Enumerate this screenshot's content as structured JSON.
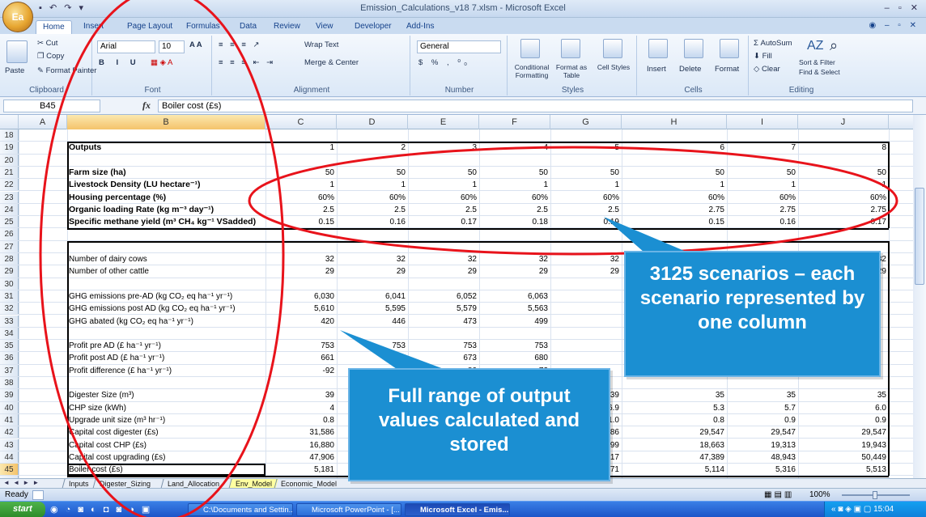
{
  "window": {
    "title": "Emission_Calculations_v18 7.xlsm - Microsoft Excel",
    "qat": "▪ ↶ ↷ ▾",
    "controls": "– ▫ ✕",
    "ribbon_controls": "◉ – ▫ ✕"
  },
  "office_button": {
    "label": "Ea"
  },
  "ribbon_tabs": [
    "Home",
    "Insert",
    "Page Layout",
    "Formulas",
    "Data",
    "Review",
    "View",
    "Developer",
    "Add-Ins"
  ],
  "ribbon": {
    "clipboard": {
      "paste": "Paste",
      "cut": "Cut",
      "copy": "Copy",
      "format_painter": "Format Painter",
      "label": "Clipboard"
    },
    "font": {
      "family": "Arial",
      "size": "10",
      "label": "Font"
    },
    "alignment": {
      "wrap": "Wrap Text",
      "merge": "Merge & Center",
      "label": "Alignment"
    },
    "number": {
      "format": "General",
      "label": "Number"
    },
    "styles": {
      "conditional": "Conditional Formatting",
      "format_table": "Format as Table",
      "cell_styles": "Cell Styles",
      "label": "Styles"
    },
    "cells": {
      "insert": "Insert",
      "delete": "Delete",
      "format": "Format",
      "label": "Cells"
    },
    "editing": {
      "autosum": "AutoSum",
      "fill": "Fill",
      "clear": "Clear",
      "sort": "Sort & Filter",
      "find": "Find & Select",
      "label": "Editing"
    }
  },
  "formula_bar": {
    "name_box": "B45",
    "fx": "fx",
    "value": "Boiler cost (£s)"
  },
  "columns": [
    "A",
    "B",
    "C",
    "D",
    "E",
    "F",
    "G",
    "H",
    "I",
    "J"
  ],
  "rows": [
    {
      "n": "18",
      "label": "",
      "bold": false,
      "values": [
        "",
        "",
        "",
        "",
        "",
        "",
        "",
        ""
      ]
    },
    {
      "n": "19",
      "label": "Outputs",
      "bold": true,
      "values": [
        "1",
        "2",
        "3",
        "4",
        "5",
        "6",
        "7",
        "8"
      ]
    },
    {
      "n": "20",
      "label": "",
      "bold": false,
      "values": [
        "",
        "",
        "",
        "",
        "",
        "",
        "",
        ""
      ]
    },
    {
      "n": "21",
      "label": "Farm size (ha)",
      "bold": true,
      "values": [
        "50",
        "50",
        "50",
        "50",
        "50",
        "50",
        "50",
        "50"
      ]
    },
    {
      "n": "22",
      "label": "Livestock Density (LU hectare⁻¹)",
      "bold": true,
      "values": [
        "1",
        "1",
        "1",
        "1",
        "1",
        "1",
        "1",
        "1"
      ]
    },
    {
      "n": "23",
      "label": "Housing percentage (%)",
      "bold": true,
      "values": [
        "60%",
        "60%",
        "60%",
        "60%",
        "60%",
        "60%",
        "60%",
        "60%"
      ]
    },
    {
      "n": "24",
      "label": "Organic loading Rate (kg m⁻³ day⁻¹)",
      "bold": true,
      "values": [
        "2.5",
        "2.5",
        "2.5",
        "2.5",
        "2.5",
        "2.75",
        "2.75",
        "2.75"
      ]
    },
    {
      "n": "25",
      "label": "Specific methane yield (m³ CH₄ kg⁻¹ VSadded)",
      "bold": true,
      "values": [
        "0.15",
        "0.16",
        "0.17",
        "0.18",
        "0.19",
        "0.15",
        "0.16",
        "0.17"
      ]
    },
    {
      "n": "26",
      "label": "",
      "bold": false,
      "values": [
        "",
        "",
        "",
        "",
        "",
        "",
        "",
        ""
      ]
    },
    {
      "n": "27",
      "label": "",
      "bold": false,
      "values": [
        "",
        "",
        "",
        "",
        "",
        "",
        "",
        ""
      ]
    },
    {
      "n": "28",
      "label": "Number of dairy cows",
      "bold": false,
      "values": [
        "32",
        "32",
        "32",
        "32",
        "32",
        "32",
        "32",
        "32"
      ]
    },
    {
      "n": "29",
      "label": "Number of other cattle",
      "bold": false,
      "values": [
        "29",
        "29",
        "29",
        "29",
        "29",
        "29",
        "29",
        "29"
      ]
    },
    {
      "n": "30",
      "label": "",
      "bold": false,
      "values": [
        "",
        "",
        "",
        "",
        "",
        "",
        "",
        ""
      ]
    },
    {
      "n": "31",
      "label": "GHG emissions pre-AD (kg CO₂ eq ha⁻¹ yr⁻¹)",
      "bold": false,
      "values": [
        "6,030",
        "6,041",
        "6,052",
        "6,063",
        "",
        "",
        "",
        ""
      ]
    },
    {
      "n": "32",
      "label": "GHG emissions post AD (kg CO₂ eq ha⁻¹ yr⁻¹)",
      "bold": false,
      "values": [
        "5,610",
        "5,595",
        "5,579",
        "5,563",
        "",
        "",
        "",
        ""
      ]
    },
    {
      "n": "33",
      "label": "GHG abated (kg CO₂ eq ha⁻¹ yr⁻¹)",
      "bold": false,
      "values": [
        "420",
        "446",
        "473",
        "499",
        "",
        "",
        "",
        ""
      ]
    },
    {
      "n": "34",
      "label": "",
      "bold": false,
      "values": [
        "",
        "",
        "",
        "",
        "",
        "",
        "",
        ""
      ]
    },
    {
      "n": "35",
      "label": "Profit pre AD (£ ha⁻¹ yr⁻¹)",
      "bold": false,
      "values": [
        "753",
        "753",
        "753",
        "753",
        "",
        "",
        "",
        ""
      ]
    },
    {
      "n": "36",
      "label": "Profit post AD (£ ha⁻¹ yr⁻¹)",
      "bold": false,
      "values": [
        "661",
        "667",
        "673",
        "680",
        "",
        "",
        "",
        ""
      ]
    },
    {
      "n": "37",
      "label": "Profit difference (£ ha⁻¹ yr⁻¹)",
      "bold": false,
      "values": [
        "-92",
        "-86",
        "-80",
        "-73",
        "",
        "",
        "",
        ""
      ]
    },
    {
      "n": "38",
      "label": "",
      "bold": false,
      "values": [
        "",
        "",
        "",
        "",
        "",
        "",
        "",
        ""
      ]
    },
    {
      "n": "39",
      "label": "Digester Size (m³)",
      "bold": false,
      "values": [
        "39",
        "",
        "",
        "",
        "39",
        "35",
        "35",
        "35"
      ]
    },
    {
      "n": "40",
      "label": "CHP size (kWh)",
      "bold": false,
      "values": [
        "4",
        "",
        "",
        "",
        "6.9",
        "5.3",
        "5.7",
        "6.0"
      ]
    },
    {
      "n": "41",
      "label": "Upgrade unit size (m³ hr⁻¹)",
      "bold": false,
      "values": [
        "0.8",
        "",
        "",
        "",
        "1.0",
        "0.8",
        "0.9",
        "0.9"
      ]
    },
    {
      "n": "42",
      "label": "Capital cost digester (£s)",
      "bold": false,
      "values": [
        "31,586",
        "",
        "",
        "",
        "31,586",
        "29,547",
        "29,547",
        "29,547"
      ]
    },
    {
      "n": "43",
      "label": "Capital cost CHP (£s)",
      "bold": false,
      "values": [
        "16,880",
        "",
        "",
        "",
        "21,399",
        "18,663",
        "19,313",
        "19,943"
      ]
    },
    {
      "n": "44",
      "label": "Capital cost upgrading (£s)",
      "bold": false,
      "values": [
        "47,906",
        "",
        "",
        "",
        "53,917",
        "47,389",
        "48,943",
        "50,449"
      ]
    },
    {
      "n": "45",
      "label": "Boiler cost (£s)",
      "bold": false,
      "values": [
        "5,181",
        "",
        "",
        "",
        "5,971",
        "5,114",
        "5,316",
        "5,513"
      ]
    },
    {
      "n": "46",
      "label": "",
      "bold": false,
      "values": [
        "",
        "",
        "",
        "",
        "",
        "",
        "",
        ""
      ]
    }
  ],
  "sheet_tabs": [
    "Inputs",
    "Digester_Sizing",
    "Land_Allocation",
    "Env_Model",
    "Economic_Model"
  ],
  "active_sheet": "Env_Model",
  "sheet_nav": "◄ ◄ ► ►",
  "status": {
    "ready": "Ready",
    "zoom": "100%"
  },
  "callouts": {
    "scenarios": "3125 scenarios – each scenario represented by one column",
    "outputs": "Full range of output values calculated and stored"
  },
  "taskbar": {
    "start": "start",
    "items": [
      "C:\\Documents and Settin...",
      "Microsoft PowerPoint - [...",
      "Microsoft Excel - Emis..."
    ],
    "clock": "15:04"
  },
  "colors": {
    "callout": "#1b8fd2",
    "ellipse": "#e8131b"
  }
}
